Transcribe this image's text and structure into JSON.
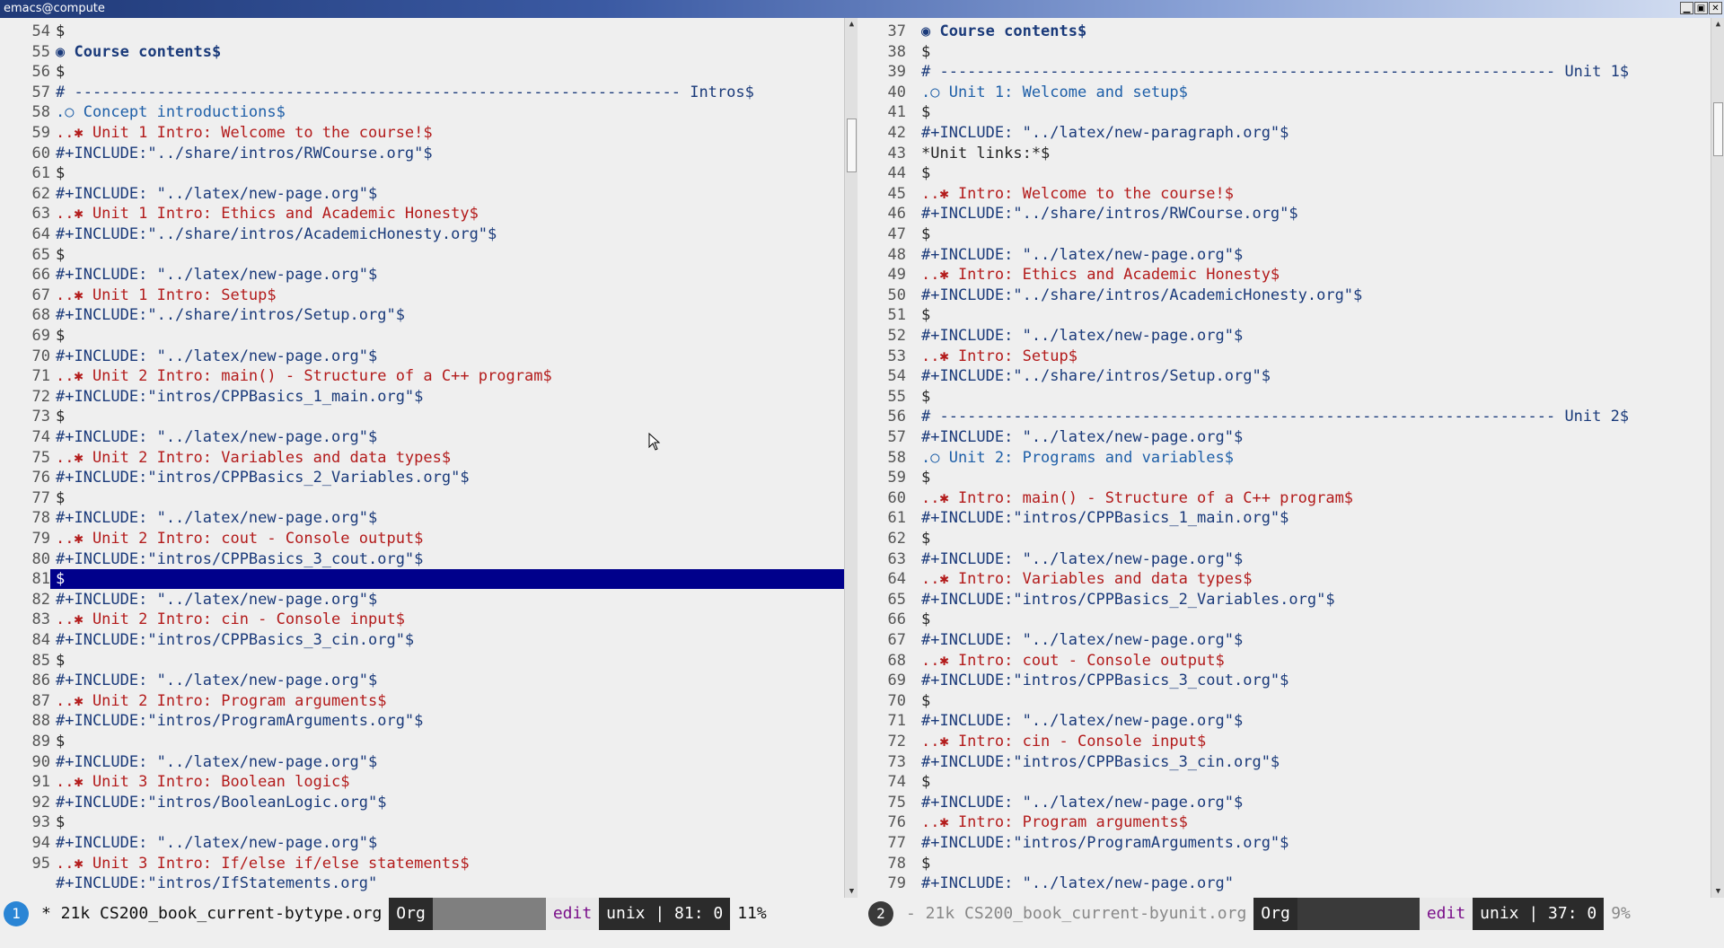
{
  "window": {
    "title": "emacs@compute",
    "buttons": {
      "minimize": "▁",
      "maximize": "▣",
      "close": "✕"
    }
  },
  "left_pane": {
    "first_line": 54,
    "lines": [
      {
        "n": "54",
        "text": "$",
        "kind": "blank"
      },
      {
        "n": "55",
        "text": "◉ Course contents$",
        "kind": "h1"
      },
      {
        "n": "56",
        "text": "$",
        "kind": "blank"
      },
      {
        "n": "57",
        "text": "# ------------------------------------------------------------------ Intros$",
        "kind": "sep"
      },
      {
        "n": "58",
        "text": ".○ Concept introductions$",
        "kind": "h1c"
      },
      {
        "n": "59",
        "text": "..✱ Unit 1 Intro: Welcome to the course!$",
        "kind": "h2"
      },
      {
        "n": "60",
        "text": "#+INCLUDE:\"../share/intros/RWCourse.org\"$",
        "kind": "include"
      },
      {
        "n": "61",
        "text": "$",
        "kind": "blank"
      },
      {
        "n": "62",
        "text": "#+INCLUDE: \"../latex/new-page.org\"$",
        "kind": "include"
      },
      {
        "n": "63",
        "text": "..✱ Unit 1 Intro: Ethics and Academic Honesty$",
        "kind": "h2"
      },
      {
        "n": "64",
        "text": "#+INCLUDE:\"../share/intros/AcademicHonesty.org\"$",
        "kind": "include"
      },
      {
        "n": "65",
        "text": "$",
        "kind": "blank"
      },
      {
        "n": "66",
        "text": "#+INCLUDE: \"../latex/new-page.org\"$",
        "kind": "include"
      },
      {
        "n": "67",
        "text": "..✱ Unit 1 Intro: Setup$",
        "kind": "h2"
      },
      {
        "n": "68",
        "text": "#+INCLUDE:\"../share/intros/Setup.org\"$",
        "kind": "include"
      },
      {
        "n": "69",
        "text": "$",
        "kind": "blank"
      },
      {
        "n": "70",
        "text": "#+INCLUDE: \"../latex/new-page.org\"$",
        "kind": "include"
      },
      {
        "n": "71",
        "text": "..✱ Unit 2 Intro: main() - Structure of a C++ program$",
        "kind": "h2"
      },
      {
        "n": "72",
        "text": "#+INCLUDE:\"intros/CPPBasics_1_main.org\"$",
        "kind": "include"
      },
      {
        "n": "73",
        "text": "$",
        "kind": "blank"
      },
      {
        "n": "74",
        "text": "#+INCLUDE: \"../latex/new-page.org\"$",
        "kind": "include"
      },
      {
        "n": "75",
        "text": "..✱ Unit 2 Intro: Variables and data types$",
        "kind": "h2"
      },
      {
        "n": "76",
        "text": "#+INCLUDE:\"intros/CPPBasics_2_Variables.org\"$",
        "kind": "include"
      },
      {
        "n": "77",
        "text": "$",
        "kind": "blank"
      },
      {
        "n": "78",
        "text": "#+INCLUDE: \"../latex/new-page.org\"$",
        "kind": "include"
      },
      {
        "n": "79",
        "text": "..✱ Unit 2 Intro: cout - Console output$",
        "kind": "h2"
      },
      {
        "n": "80",
        "text": "#+INCLUDE:\"intros/CPPBasics_3_cout.org\"$",
        "kind": "include"
      },
      {
        "n": "81",
        "text": "$",
        "kind": "cursor"
      },
      {
        "n": "82",
        "text": "#+INCLUDE: \"../latex/new-page.org\"$",
        "kind": "include"
      },
      {
        "n": "83",
        "text": "..✱ Unit 2 Intro: cin - Console input$",
        "kind": "h2"
      },
      {
        "n": "84",
        "text": "#+INCLUDE:\"intros/CPPBasics_3_cin.org\"$",
        "kind": "include"
      },
      {
        "n": "85",
        "text": "$",
        "kind": "blank"
      },
      {
        "n": "86",
        "text": "#+INCLUDE: \"../latex/new-page.org\"$",
        "kind": "include"
      },
      {
        "n": "87",
        "text": "..✱ Unit 2 Intro: Program arguments$",
        "kind": "h2"
      },
      {
        "n": "88",
        "text": "#+INCLUDE:\"intros/ProgramArguments.org\"$",
        "kind": "include"
      },
      {
        "n": "89",
        "text": "$",
        "kind": "blank"
      },
      {
        "n": "90",
        "text": "#+INCLUDE: \"../latex/new-page.org\"$",
        "kind": "include"
      },
      {
        "n": "91",
        "text": "..✱ Unit 3 Intro: Boolean logic$",
        "kind": "h2"
      },
      {
        "n": "92",
        "text": "#+INCLUDE:\"intros/BooleanLogic.org\"$",
        "kind": "include"
      },
      {
        "n": "93",
        "text": "$",
        "kind": "blank"
      },
      {
        "n": "94",
        "text": "#+INCLUDE: \"../latex/new-page.org\"$",
        "kind": "include"
      },
      {
        "n": "95",
        "text": "..✱ Unit 3 Intro: If/else if/else statements$",
        "kind": "h2"
      },
      {
        "n": "",
        "text": "#+INCLUDE:\"intros/IfStatements.org\"",
        "kind": "include"
      }
    ],
    "scroll_fraction": 0.11
  },
  "right_pane": {
    "lines": [
      {
        "n": "37",
        "text": "◉ Course contents$",
        "kind": "h1"
      },
      {
        "n": "38",
        "text": "$",
        "kind": "blank"
      },
      {
        "n": "39",
        "text": "# ------------------------------------------------------------------- Unit 1$",
        "kind": "sep"
      },
      {
        "n": "40",
        "text": ".○ Unit 1: Welcome and setup$",
        "kind": "h1c"
      },
      {
        "n": "41",
        "text": "$",
        "kind": "blank"
      },
      {
        "n": "42",
        "text": "#+INCLUDE: \"../latex/new-paragraph.org\"$",
        "kind": "include"
      },
      {
        "n": "43",
        "text": "*Unit links:*$",
        "kind": "plain"
      },
      {
        "n": "44",
        "text": "$",
        "kind": "blank"
      },
      {
        "n": "45",
        "text": "..✱ Intro: Welcome to the course!$",
        "kind": "h2"
      },
      {
        "n": "46",
        "text": "#+INCLUDE:\"../share/intros/RWCourse.org\"$",
        "kind": "include"
      },
      {
        "n": "47",
        "text": "$",
        "kind": "blank"
      },
      {
        "n": "48",
        "text": "#+INCLUDE: \"../latex/new-page.org\"$",
        "kind": "include"
      },
      {
        "n": "49",
        "text": "..✱ Intro: Ethics and Academic Honesty$",
        "kind": "h2"
      },
      {
        "n": "50",
        "text": "#+INCLUDE:\"../share/intros/AcademicHonesty.org\"$",
        "kind": "include"
      },
      {
        "n": "51",
        "text": "$",
        "kind": "blank"
      },
      {
        "n": "52",
        "text": "#+INCLUDE: \"../latex/new-page.org\"$",
        "kind": "include"
      },
      {
        "n": "53",
        "text": "..✱ Intro: Setup$",
        "kind": "h2"
      },
      {
        "n": "54",
        "text": "#+INCLUDE:\"../share/intros/Setup.org\"$",
        "kind": "include"
      },
      {
        "n": "55",
        "text": "$",
        "kind": "blank"
      },
      {
        "n": "56",
        "text": "# ------------------------------------------------------------------- Unit 2$",
        "kind": "sep"
      },
      {
        "n": "57",
        "text": "#+INCLUDE: \"../latex/new-page.org\"$",
        "kind": "include"
      },
      {
        "n": "58",
        "text": ".○ Unit 2: Programs and variables$",
        "kind": "h1c"
      },
      {
        "n": "59",
        "text": "$",
        "kind": "blank"
      },
      {
        "n": "60",
        "text": "..✱ Intro: main() - Structure of a C++ program$",
        "kind": "h2"
      },
      {
        "n": "61",
        "text": "#+INCLUDE:\"intros/CPPBasics_1_main.org\"$",
        "kind": "include"
      },
      {
        "n": "62",
        "text": "$",
        "kind": "blank"
      },
      {
        "n": "63",
        "text": "#+INCLUDE: \"../latex/new-page.org\"$",
        "kind": "include"
      },
      {
        "n": "64",
        "text": "..✱ Intro: Variables and data types$",
        "kind": "h2"
      },
      {
        "n": "65",
        "text": "#+INCLUDE:\"intros/CPPBasics_2_Variables.org\"$",
        "kind": "include"
      },
      {
        "n": "66",
        "text": "$",
        "kind": "blank"
      },
      {
        "n": "67",
        "text": "#+INCLUDE: \"../latex/new-page.org\"$",
        "kind": "include"
      },
      {
        "n": "68",
        "text": "..✱ Intro: cout - Console output$",
        "kind": "h2"
      },
      {
        "n": "69",
        "text": "#+INCLUDE:\"intros/CPPBasics_3_cout.org\"$",
        "kind": "include"
      },
      {
        "n": "70",
        "text": "$",
        "kind": "blank"
      },
      {
        "n": "71",
        "text": "#+INCLUDE: \"../latex/new-page.org\"$",
        "kind": "include"
      },
      {
        "n": "72",
        "text": "..✱ Intro: cin - Console input$",
        "kind": "h2"
      },
      {
        "n": "73",
        "text": "#+INCLUDE:\"intros/CPPBasics_3_cin.org\"$",
        "kind": "include"
      },
      {
        "n": "74",
        "text": "$",
        "kind": "blank"
      },
      {
        "n": "75",
        "text": "#+INCLUDE: \"../latex/new-page.org\"$",
        "kind": "include"
      },
      {
        "n": "76",
        "text": "..✱ Intro: Program arguments$",
        "kind": "h2"
      },
      {
        "n": "77",
        "text": "#+INCLUDE:\"intros/ProgramArguments.org\"$",
        "kind": "include"
      },
      {
        "n": "78",
        "text": "$",
        "kind": "blank"
      },
      {
        "n": "79",
        "text": "#+INCLUDE: \"../latex/new-page.org\"",
        "kind": "include"
      }
    ],
    "scroll_fraction": 0.09
  },
  "modeline_left": {
    "window_number": "1",
    "buffer": "* 21k CS200_book_current-bytype.org",
    "mode": "Org",
    "state": "edit",
    "position": "unix | 81: 0",
    "percent": "11%"
  },
  "modeline_right": {
    "window_number": "2",
    "buffer": "- 21k CS200_book_current-byunit.org",
    "mode": "Org",
    "state": "edit",
    "position": "unix | 37: 0",
    "percent": "9%"
  },
  "icons": {
    "scroll_up": "▲",
    "scroll_down": "▼",
    "mouse_pointer": "mouse-pointer-icon"
  }
}
